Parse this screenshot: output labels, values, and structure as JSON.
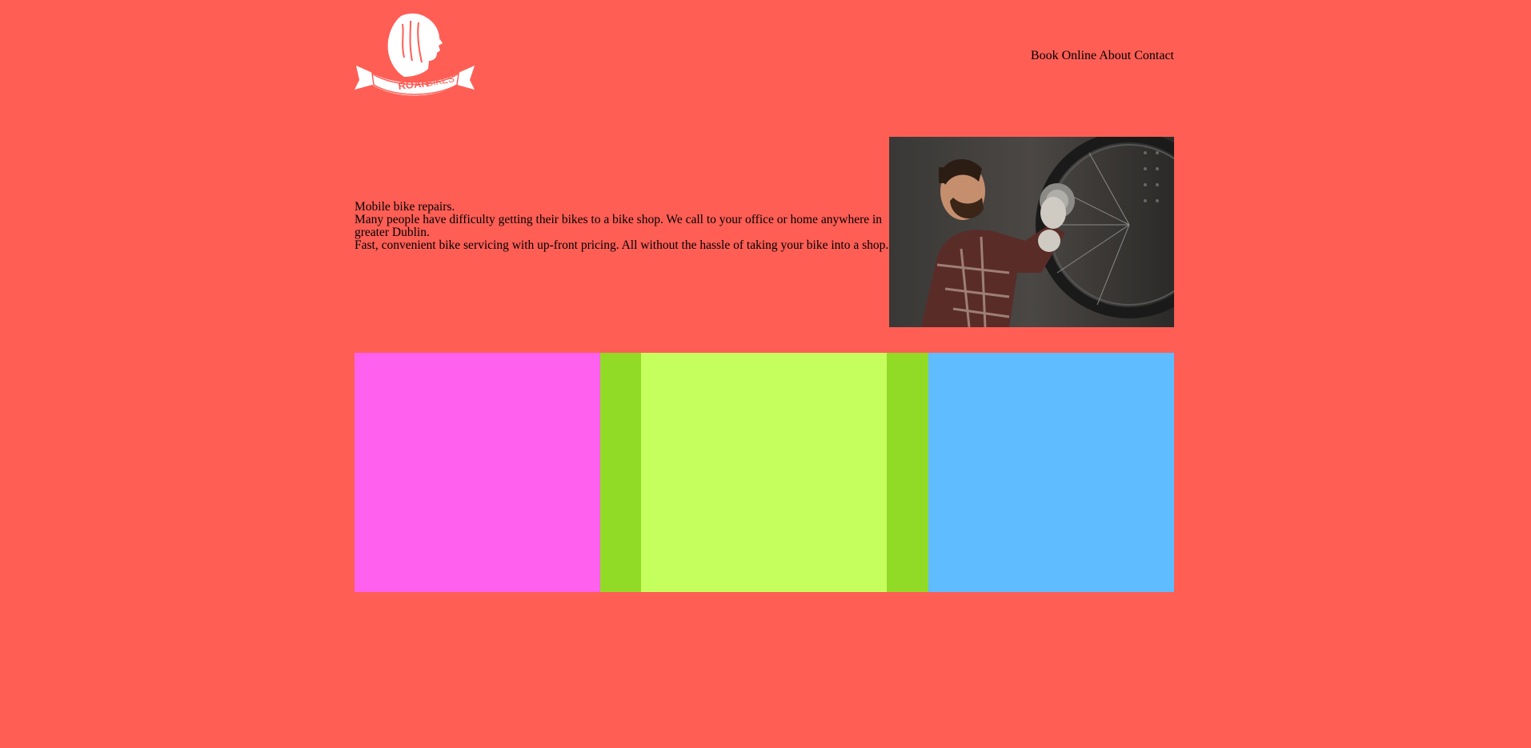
{
  "brand": {
    "logo_text_bold": "ROAR",
    "logo_text_light": "BIKES"
  },
  "nav": {
    "items": [
      {
        "label": "Book Online"
      },
      {
        "label": "About"
      },
      {
        "label": "Contact"
      }
    ]
  },
  "hero": {
    "lines": [
      "Mobile bike repairs.",
      "Many people have difficulty getting their bikes to a bike shop. We call to your office or home anywhere in greater Dublin.",
      "Fast, convenient bike servicing with up-front pricing. All without the hassle of taking your bike into a shop."
    ]
  },
  "colors": {
    "background": "#ff5e55",
    "tile_pink": "#ff60ee",
    "tile_dark_green": "#91db26",
    "tile_light_green": "#c5ff5e",
    "tile_blue": "#5fbcff"
  }
}
